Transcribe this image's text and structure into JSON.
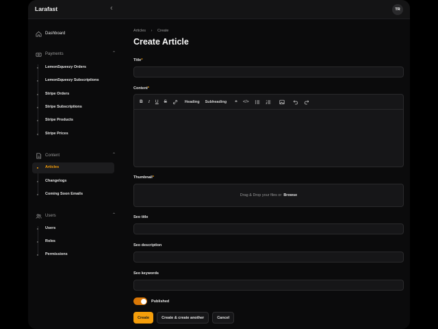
{
  "app": {
    "brand": "Larafast",
    "user_initials": "TR"
  },
  "sidebar": {
    "dashboard": "Dashboard",
    "groups": {
      "payments": {
        "label": "Payments",
        "items": [
          "LemonSqueezy Orders",
          "LemonSqueezy Subscriptions",
          "Stripe Orders",
          "Stripe Subscriptions",
          "Stripe Products",
          "Stripe Prices"
        ]
      },
      "content": {
        "label": "Content",
        "items": [
          "Articles",
          "Changelogs",
          "Coming Soon Emails"
        ]
      },
      "users": {
        "label": "Users",
        "items": [
          "Users",
          "Roles",
          "Permissions"
        ]
      }
    },
    "active_item": "Articles"
  },
  "breadcrumb": {
    "parent": "Articles",
    "current": "Create"
  },
  "page": {
    "title": "Create Article"
  },
  "form": {
    "title_label": "Title",
    "content_label": "Content",
    "toolbar": {
      "heading": "Heading",
      "subheading": "Subheading"
    },
    "thumbnail_label": "Thumbnail",
    "thumbnail_drop": "Drag & Drop your files or",
    "thumbnail_browse": "Browse",
    "seo_title_label": "Seo title",
    "seo_description_label": "Seo description",
    "seo_keywords_label": "Seo keywords",
    "published_label": "Published",
    "published": true
  },
  "actions": {
    "create": "Create",
    "create_another": "Create & create another",
    "cancel": "Cancel"
  },
  "colors": {
    "accent": "#f59e0b",
    "background": "#0b0b0c",
    "surface": "#161618"
  }
}
